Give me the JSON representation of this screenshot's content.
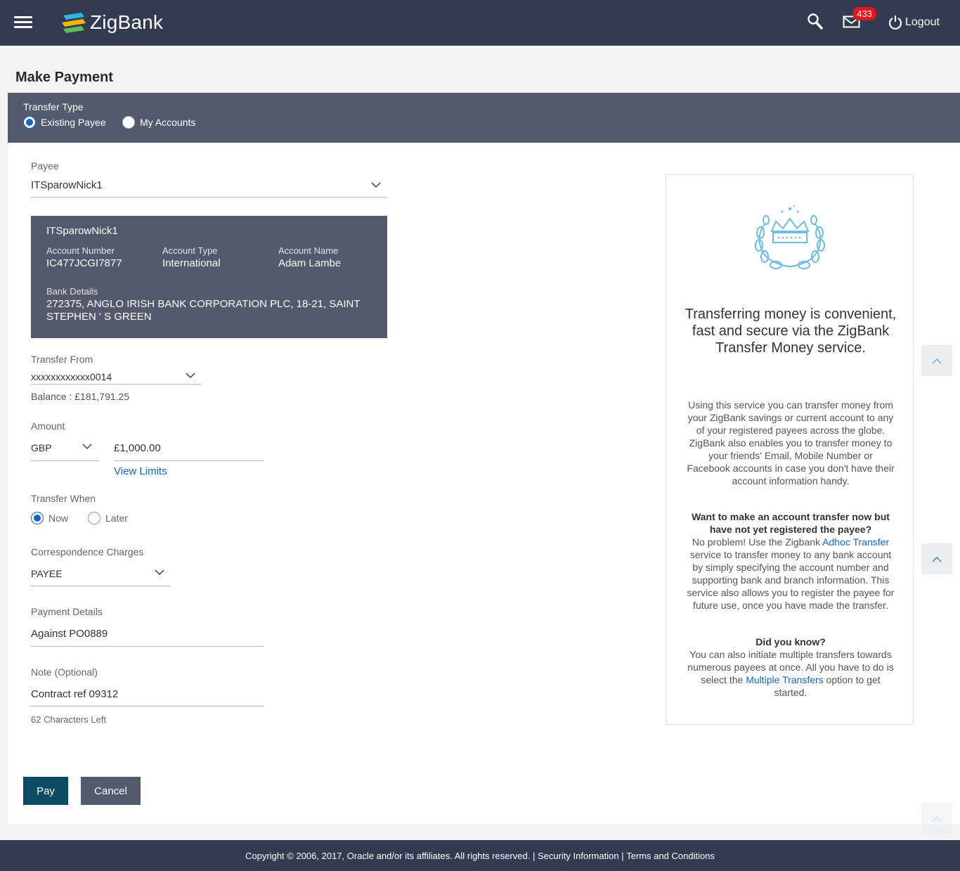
{
  "header": {
    "brand": "ZigBank",
    "notification_count": "433",
    "logout_label": "Logout"
  },
  "page": {
    "title": "Make Payment"
  },
  "transfer_type": {
    "label": "Transfer Type",
    "options": [
      "Existing Payee",
      "My Accounts"
    ],
    "selected": "Existing Payee"
  },
  "payee": {
    "label": "Payee",
    "value": "ITSparowNick1",
    "card": {
      "name": "ITSparowNick1",
      "account_number_label": "Account Number",
      "account_number": "IC477JCGI7877",
      "account_type_label": "Account Type",
      "account_type": "International",
      "account_name_label": "Account Name",
      "account_name": "Adam Lambe",
      "bank_details_label": "Bank Details",
      "bank_details": "272375, ANGLO IRISH BANK CORPORATION PLC, 18-21, SAINT STEPHEN ' S GREEN"
    }
  },
  "transfer_from": {
    "label": "Transfer From",
    "value": "xxxxxxxxxxxx0014",
    "balance": "Balance : £181,791.25"
  },
  "amount": {
    "label": "Amount",
    "currency": "GBP",
    "value": "£1,000.00",
    "view_limits": "View Limits"
  },
  "transfer_when": {
    "label": "Transfer When",
    "options": [
      "Now",
      "Later"
    ],
    "selected": "Now"
  },
  "correspondence_charges": {
    "label": "Correspondence Charges",
    "value": "PAYEE"
  },
  "payment_details": {
    "label": "Payment Details",
    "value": "Against PO0889"
  },
  "note": {
    "label": "Note (Optional)",
    "value": "Contract ref 09312",
    "chars_left": "62 Characters Left"
  },
  "buttons": {
    "pay": "Pay",
    "cancel": "Cancel"
  },
  "info": {
    "heading": "Transferring money is convenient, fast and secure via the ZigBank Transfer Money service.",
    "para1": "Using this service you can transfer money from your ZigBank savings or current account to any of your registered payees across the globe. ZigBank also enables you to transfer money to your friends' Email, Mobile Number or Facebook accounts in case you don't have their account information handy.",
    "q1": "Want to make an account transfer now but have not yet registered the payee?",
    "p2_pre": "No problem! Use the Zigbank ",
    "p2_link": "Adhoc Transfer",
    "p2_post": " service to transfer money to any bank account by simply specifying the account number and supporting bank and branch information. This service also allows you to register the payee for future use, once you have made the transfer.",
    "q2": "Did you know?",
    "p3_pre": "You can also initiate multiple transfers towards numerous payees at once. All you have to do is select the ",
    "p3_link": "Multiple Transfers",
    "p3_post": " option to get started."
  },
  "footer": {
    "copyright": "Copyright © 2006, 2017, Oracle and/or its affiliates. All rights reserved. |",
    "security": "Security Information",
    "sep": "|",
    "terms": "Terms and Conditions"
  }
}
